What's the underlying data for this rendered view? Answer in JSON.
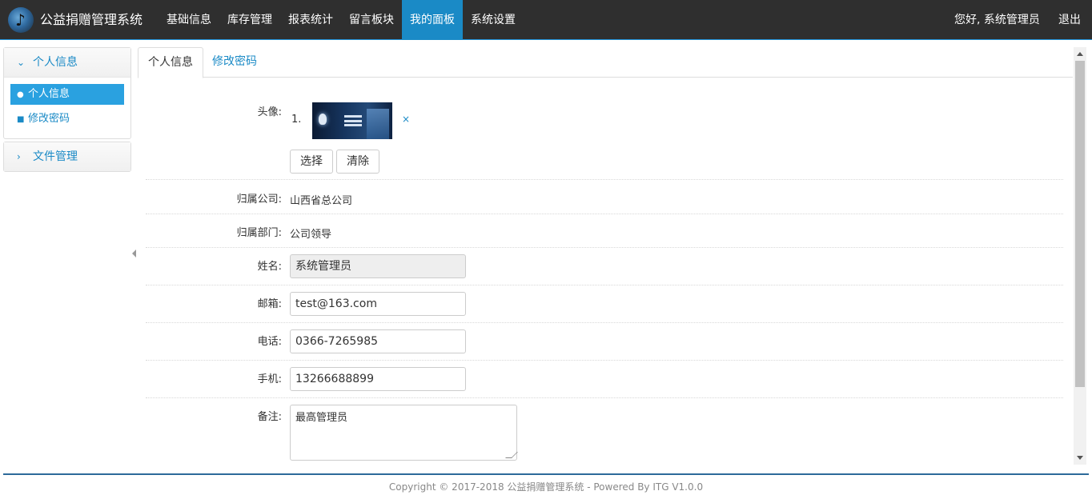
{
  "app": {
    "title": "公益捐赠管理系统"
  },
  "nav": {
    "items": [
      {
        "label": "基础信息"
      },
      {
        "label": "库存管理"
      },
      {
        "label": "报表统计"
      },
      {
        "label": "留言板块"
      },
      {
        "label": "我的面板",
        "active": true
      },
      {
        "label": "系统设置"
      }
    ],
    "greeting": "您好, 系统管理员",
    "logout": "退出"
  },
  "sidebar": {
    "group1": {
      "title": "个人信息",
      "icon": "chevron-down-icon",
      "items": [
        {
          "label": "个人信息",
          "icon": "user-icon",
          "active": true
        },
        {
          "label": "修改密码",
          "icon": "lock-icon"
        }
      ]
    },
    "group2": {
      "title": "文件管理",
      "icon": "chevron-right-icon"
    }
  },
  "tabs": [
    {
      "label": "个人信息",
      "active": true
    },
    {
      "label": "修改密码"
    }
  ],
  "form": {
    "avatar": {
      "label": "头像:",
      "index": "1.",
      "remove": "×",
      "choose": "选择",
      "clear": "清除"
    },
    "company": {
      "label": "归属公司:",
      "value": "山西省总公司"
    },
    "department": {
      "label": "归属部门:",
      "value": "公司领导"
    },
    "name": {
      "label": "姓名:",
      "value": "系统管理员"
    },
    "email": {
      "label": "邮箱:",
      "value": "test@163.com"
    },
    "phone": {
      "label": "电话:",
      "value": "0366-7265985"
    },
    "mobile": {
      "label": "手机:",
      "value": "13266688899"
    },
    "remark": {
      "label": "备注:",
      "value": "最高管理员"
    }
  },
  "footer": {
    "text": "Copyright © 2017-2018 公益捐赠管理系统 - Powered By ITG V1.0.0"
  },
  "colors": {
    "accent": "#1a8ac6",
    "topbar": "#2f2f2f"
  }
}
